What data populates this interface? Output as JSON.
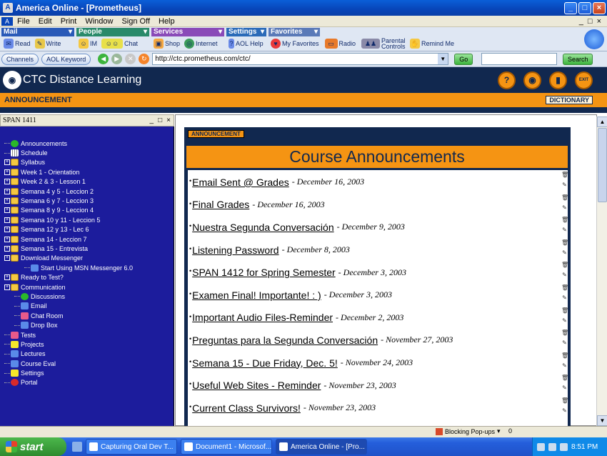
{
  "window": {
    "title": "America  Online - [Prometheus]",
    "controls": [
      "_",
      "□",
      "×"
    ]
  },
  "menubar": {
    "items": [
      "File",
      "Edit",
      "Print",
      "Window",
      "Sign Off",
      "Help"
    ],
    "inner_controls": [
      "_",
      "□",
      "×"
    ]
  },
  "aol_toolbar": {
    "groups": [
      {
        "name": "Mail",
        "color": "#2a5ab8",
        "items": [
          "Read",
          "Write"
        ]
      },
      {
        "name": "People",
        "color": "#2a8a6a",
        "items": [
          "IM",
          "Chat"
        ]
      },
      {
        "name": "Services",
        "color": "#8a4ab8",
        "items": [
          "Shop",
          "Internet"
        ]
      },
      {
        "name": "Settings",
        "color": "#2a6ab8",
        "items": [
          "AOL Help"
        ]
      },
      {
        "name": "Favorites",
        "color": "#5a7ab8",
        "items": [
          "My Favorites",
          "Radio",
          "Parental Controls",
          "Remind Me"
        ]
      }
    ]
  },
  "addressbar": {
    "channels": "Channels",
    "keyword": "AOL Keyword",
    "url": "http://ctc.prometheus.com/ctc/",
    "go": "Go",
    "search": "Search"
  },
  "ctc": {
    "title": "CTC Distance Learning",
    "section": "ANNOUNCEMENT",
    "dictionary": "DICTIONARY",
    "buttons": [
      "?",
      "eye",
      "doc",
      "EXIT"
    ]
  },
  "sidebar": {
    "course": "SPAN 1411",
    "controls": [
      "_",
      "□",
      "×"
    ],
    "items": [
      {
        "label": "Announcements",
        "indent": 0,
        "icon": "green",
        "expander": false
      },
      {
        "label": "Schedule",
        "indent": 0,
        "icon": "grid",
        "expander": false
      },
      {
        "label": "Syllabus",
        "indent": 0,
        "icon": "folder",
        "expander": true
      },
      {
        "label": "Week 1 - Orientation",
        "indent": 0,
        "icon": "folder",
        "expander": true
      },
      {
        "label": "Week 2 & 3 - Lesson 1",
        "indent": 0,
        "icon": "folder",
        "expander": true
      },
      {
        "label": "Semana 4 y 5 - Leccion 2",
        "indent": 0,
        "icon": "folder",
        "expander": true
      },
      {
        "label": "Semana 6 y 7 - Leccion 3",
        "indent": 0,
        "icon": "folder",
        "expander": true
      },
      {
        "label": "Semana 8 y 9 - Leccion 4",
        "indent": 0,
        "icon": "folder",
        "expander": true
      },
      {
        "label": "Semana 10 y 11 - Leccion 5",
        "indent": 0,
        "icon": "folder",
        "expander": true
      },
      {
        "label": "Semana 12 y 13 - Lec 6",
        "indent": 0,
        "icon": "folder",
        "expander": true
      },
      {
        "label": "Semana 14 - Leccion 7",
        "indent": 0,
        "icon": "folder",
        "expander": true
      },
      {
        "label": "Semana 15 - Entrevista",
        "indent": 0,
        "icon": "folder",
        "expander": true
      },
      {
        "label": "Download Messenger",
        "indent": 0,
        "icon": "folder",
        "expander": true
      },
      {
        "label": "Start Using MSN Messenger 6.0",
        "indent": 2,
        "icon": "blue",
        "expander": false
      },
      {
        "label": "Ready to Test?",
        "indent": 0,
        "icon": "folder",
        "expander": true
      },
      {
        "label": "Communication",
        "indent": 0,
        "icon": "folder",
        "expander": true
      },
      {
        "label": "Discussions",
        "indent": 1,
        "icon": "green",
        "expander": false
      },
      {
        "label": "Email",
        "indent": 1,
        "icon": "blue",
        "expander": false
      },
      {
        "label": "Chat Room",
        "indent": 1,
        "icon": "pink",
        "expander": false
      },
      {
        "label": "Drop Box",
        "indent": 1,
        "icon": "blue",
        "expander": false
      },
      {
        "label": "Tests",
        "indent": 0,
        "icon": "pink",
        "expander": false
      },
      {
        "label": "Projects",
        "indent": 0,
        "icon": "yellow",
        "expander": false
      },
      {
        "label": "Lectures",
        "indent": 0,
        "icon": "blue",
        "expander": false
      },
      {
        "label": "Course Eval",
        "indent": 0,
        "icon": "blue",
        "expander": false
      },
      {
        "label": "Settings",
        "indent": 0,
        "icon": "yellow",
        "expander": false
      },
      {
        "label": "Portal",
        "indent": 0,
        "icon": "red",
        "expander": false
      }
    ]
  },
  "main": {
    "label": "ANNOUNCEMENT",
    "header": "Course Announcements",
    "announcements": [
      {
        "title": "Email Sent @ Grades",
        "date": "December 16, 2003"
      },
      {
        "title": "Final Grades",
        "date": "December 16, 2003"
      },
      {
        "title": "Nuestra Segunda Conversación",
        "date": "December 9, 2003"
      },
      {
        "title": "Listening Password",
        "date": "December 8, 2003"
      },
      {
        "title": "SPAN 1412 for Spring Semester",
        "date": "December 3, 2003"
      },
      {
        "title": "Examen Final!  Importante!  : )",
        "date": "December 3, 2003"
      },
      {
        "title": "Important Audio Files-Reminder",
        "date": "December 2, 2003"
      },
      {
        "title": "Preguntas para la Segunda Conversación",
        "date": "November 27, 2003"
      },
      {
        "title": "Semana 15 - Due Friday, Dec. 5!",
        "date": "November 24, 2003"
      },
      {
        "title": "Useful Web Sites - Reminder",
        "date": "November 23, 2003"
      },
      {
        "title": "Current Class Survivors!",
        "date": "November 23, 2003"
      }
    ]
  },
  "status": {
    "popups": "Blocking Pop-ups",
    "count": "0"
  },
  "taskbar": {
    "start": "start",
    "tasks": [
      {
        "label": "Capturing Oral Dev T...",
        "active": false
      },
      {
        "label": "Document1 - Microsof...",
        "active": false
      },
      {
        "label": "America  Online - [Pro...",
        "active": true
      }
    ],
    "time": "8:51 PM"
  }
}
